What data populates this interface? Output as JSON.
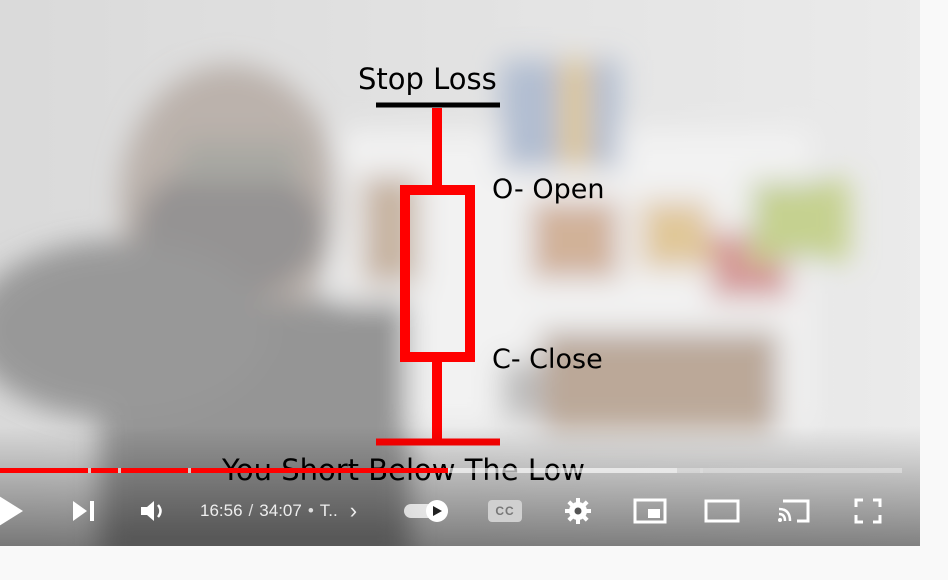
{
  "video": {
    "diagram": {
      "stop_loss": "Stop Loss",
      "open": "O- Open",
      "close": "C- Close",
      "subtitle": "You Short Below The Low"
    },
    "colors": {
      "candle": "#ff0000",
      "progress_played": "#ff0000"
    }
  },
  "player": {
    "progress": {
      "played_fraction": 0.497
    },
    "controls": {
      "current_time": "16:56",
      "separator": "/",
      "duration": "34:07",
      "chapter_bullet": "•",
      "chapter": "T..",
      "chapter_chevron": "›",
      "cc_label": "CC"
    }
  }
}
